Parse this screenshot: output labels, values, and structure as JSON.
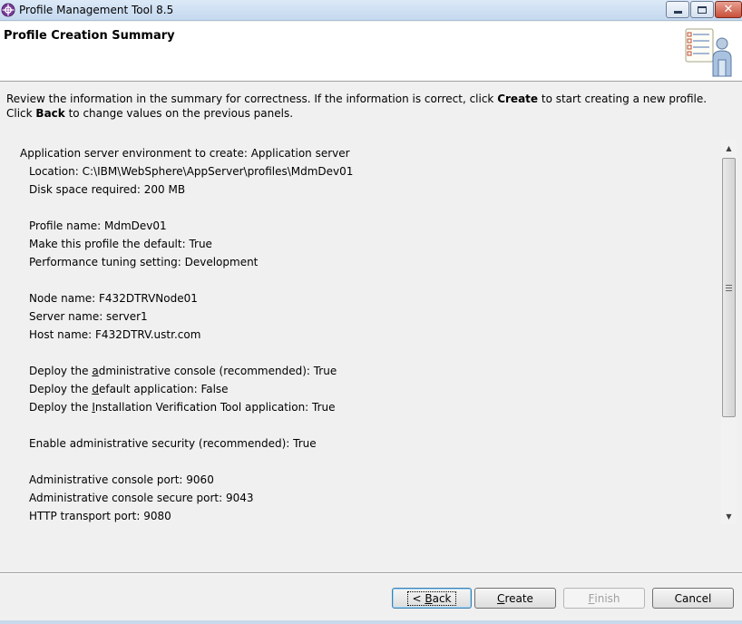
{
  "window": {
    "title": "Profile Management Tool 8.5",
    "controls": {
      "minimize": "minimize",
      "maximize": "maximize",
      "close": "✕"
    }
  },
  "header": {
    "title": "Profile Creation Summary"
  },
  "intro": {
    "part1": "Review the information in the summary for correctness. If the information is correct, click ",
    "create_word": "Create",
    "part2": " to start creating a new profile. Click ",
    "back_word": "Back",
    "part3": " to change values on the previous panels."
  },
  "summary": {
    "env": "Application server environment to create: Application server",
    "location": "Location: C:\\IBM\\WebSphere\\AppServer\\profiles\\MdmDev01",
    "disk": "Disk space required: 200 MB",
    "profile_name": "Profile name: MdmDev01",
    "default": "Make this profile the default: True",
    "tuning": "Performance tuning setting: Development",
    "node": "Node name: F432DTRVNode01",
    "server": "Server name: server1",
    "host": "Host name: F432DTRV.ustr.com",
    "admin_console": {
      "pre": "Deploy the ",
      "key": "a",
      "post": "dministrative console (recommended): True"
    },
    "default_app": {
      "pre": "Deploy the ",
      "key": "d",
      "post": "efault application: False"
    },
    "ivt_app": {
      "pre": "Deploy the ",
      "key": "I",
      "post": "nstallation Verification Tool application: True"
    },
    "security": "Enable administrative security (recommended): True",
    "admin_port": "Administrative console port: 9060",
    "admin_secure_port": "Administrative console secure port: 9043",
    "http_port": "HTTP transport port: 9080"
  },
  "buttons": {
    "back": {
      "pre": "< ",
      "key": "B",
      "post": "ack"
    },
    "create": {
      "key": "C",
      "post": "reate"
    },
    "finish": {
      "key": "F",
      "post": "inish"
    },
    "cancel": "Cancel"
  },
  "colors": {
    "titlebar": "#c4d8ef",
    "close": "#c94f3a",
    "accent": "#3c7fb1"
  }
}
